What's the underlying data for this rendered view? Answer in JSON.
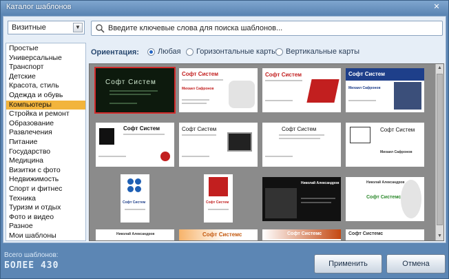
{
  "window": {
    "title": "Каталог шаблонов",
    "close_glyph": "✕"
  },
  "category_select": {
    "value": "Визитные"
  },
  "search": {
    "placeholder": "Введите ключевые слова для поиска шаблонов..."
  },
  "categories": [
    "Простые",
    "Универсальные",
    "Транспорт",
    "Детские",
    "Красота, стиль",
    "Одежда и обувь",
    "Компьютеры",
    "Стройка и ремонт",
    "Образование",
    "Развлечения",
    "Питание",
    "Государство",
    "Медицина",
    "Визитки с фото",
    "Недвижимость",
    "Спорт и фитнес",
    "Техника",
    "Туризм и отдых",
    "Фото и видео",
    "Разное",
    "Мои шаблоны"
  ],
  "selected_category_index": 6,
  "orientation": {
    "label": "Ориентация:",
    "options": [
      "Любая",
      "Горизонтальные карты",
      "Вертикальные карты"
    ],
    "selected": 0
  },
  "templates": {
    "company": "Софт Систем",
    "company_variant": "Софт Системс",
    "person_1": "Михаил Сафронов",
    "person_2": "Николай Александров"
  },
  "footer": {
    "count_label": "Всего шаблонов:",
    "count_value": "БОЛЕЕ 430",
    "apply": "Применить",
    "cancel": "Отмена"
  },
  "colors": {
    "accent_selected": "#f2b43c",
    "brand_red": "#c21f1f",
    "window_blue": "#5c86b4"
  }
}
